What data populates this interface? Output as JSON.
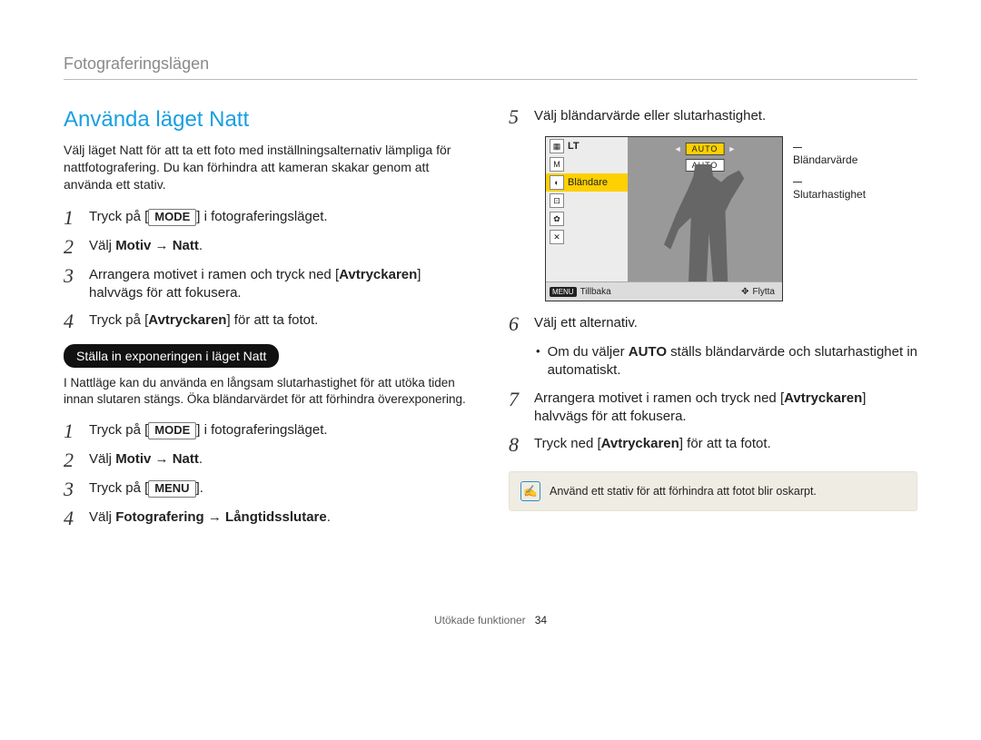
{
  "breadcrumb": "Fotograferingslägen",
  "left": {
    "title": "Använda läget Natt",
    "intro": "Välj läget Natt för att ta ett foto med inställningsalternativ lämpliga för nattfotografering. Du kan förhindra att kameran skakar genom att använda ett stativ.",
    "steps_a": {
      "s1_pre": "Tryck på [",
      "s1_mode": "MODE",
      "s1_post": "] i fotograferingsläget.",
      "s2_pre": "Välj ",
      "s2_b1": "Motiv",
      "s2_arrow": " → ",
      "s2_b2": "Natt",
      "s2_post": ".",
      "s3_pre": "Arrangera motivet i ramen och tryck ned [",
      "s3_b": "Avtryckaren",
      "s3_post_a": "]",
      "s3_line2": "halvvägs för att fokusera.",
      "s4_pre": "Tryck på [",
      "s4_b": "Avtryckaren",
      "s4_post": "] för att ta fotot."
    },
    "subhead": "Ställa in exponeringen i läget Natt",
    "subintro": "I Nattläge kan du använda en långsam slutarhastighet för att utöka tiden innan slutaren stängs. Öka bländarvärdet för att förhindra överexponering.",
    "steps_b": {
      "s1_pre": "Tryck på [",
      "s1_mode": "MODE",
      "s1_post": "] i fotograferingsläget.",
      "s2_pre": "Välj ",
      "s2_b1": "Motiv",
      "s2_arrow": " → ",
      "s2_b2": "Natt",
      "s2_post": ".",
      "s3_pre": "Tryck på [",
      "s3_mode": "MENU",
      "s3_post": "].",
      "s4_pre": "Välj ",
      "s4_b1": "Fotografering",
      "s4_arrow": " → ",
      "s4_b2": "Långtidsslutare",
      "s4_post": "."
    }
  },
  "right": {
    "s5": "Välj bländarvärde eller slutarhastighet.",
    "lcd": {
      "left_rows": {
        "lt": "LT",
        "blandare": "Bländare",
        "m_icon": "M",
        "auto1": "AUTO",
        "auto2": "AUTO"
      },
      "callout1": "Bländarvärde",
      "callout2": "Slutarhastighet",
      "bottom_menu": "MENU",
      "bottom_back": "Tillbaka",
      "bottom_move": "Flytta"
    },
    "s6": "Välj ett alternativ.",
    "s6_bullet_pre": "Om du väljer ",
    "s6_bullet_b": "AUTO",
    "s6_bullet_post": " ställs bländarvärde och slutarhastighet in automatiskt.",
    "s7_pre": "Arrangera motivet i ramen och tryck ned [",
    "s7_b": "Avtryckaren",
    "s7_post_a": "]",
    "s7_line2": "halvvägs för att fokusera.",
    "s8_pre": "Tryck ned [",
    "s8_b": "Avtryckaren",
    "s8_post": "] för att ta fotot.",
    "tip": "Använd ett stativ för att förhindra att fotot blir oskarpt."
  },
  "footer": {
    "label": "Utökade funktioner",
    "page": "34"
  },
  "nums": {
    "n1": "1",
    "n2": "2",
    "n3": "3",
    "n4": "4",
    "n5": "5",
    "n6": "6",
    "n7": "7",
    "n8": "8"
  },
  "tip_icon": "✍"
}
